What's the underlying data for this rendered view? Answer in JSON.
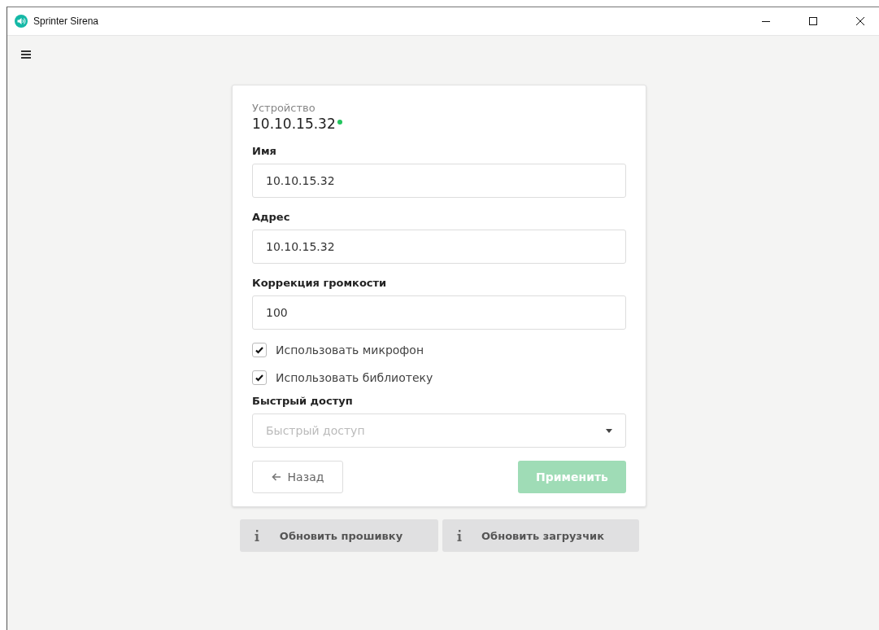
{
  "window": {
    "title": "Sprinter Sirena"
  },
  "device": {
    "caption": "Устройство",
    "address": "10.10.15.32",
    "color": "#22c55e"
  },
  "fields": [
    {
      "label": "Имя",
      "value": "10.10.15.32"
    },
    {
      "label": "Адрес",
      "value": "10.10.15.32"
    },
    {
      "label": "Коррекция громкости",
      "value": "100"
    }
  ],
  "checkboxes": [
    {
      "label": "Использовать микрофон",
      "checked": true
    },
    {
      "label": "Использовать библиотеку",
      "checked": true
    }
  ],
  "quick_access": {
    "label": "Быстрый доступ",
    "placeholder": "Быстрый доступ"
  },
  "back_button": {
    "label": "Назад"
  },
  "apply_button": {
    "label": "Применить",
    "disabled": true
  },
  "update_buttons": [
    {
      "label": "Обновить прошивку"
    },
    {
      "label": "Обновить загрузчик"
    }
  ]
}
